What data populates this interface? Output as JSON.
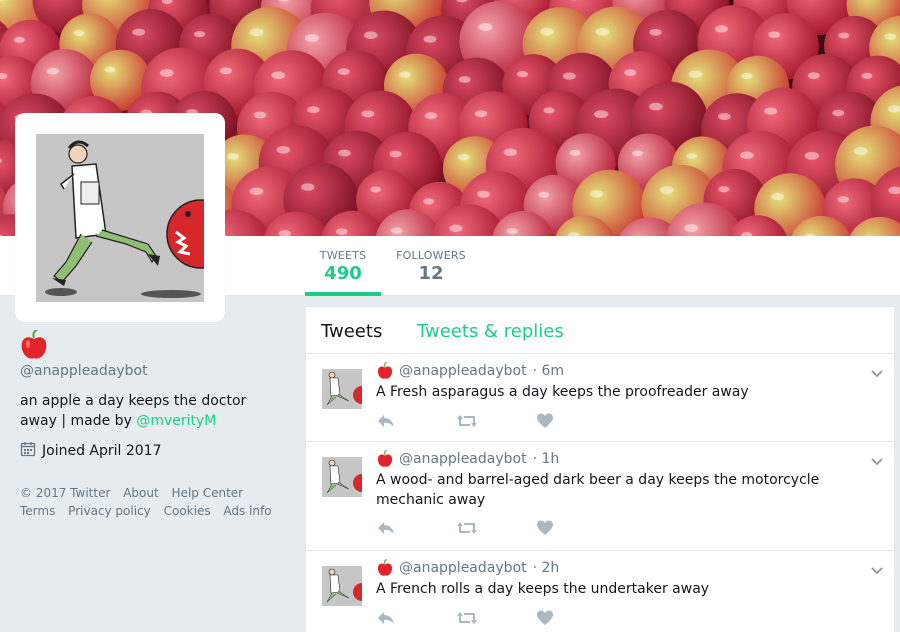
{
  "profile": {
    "handle": "@anappleadaybot",
    "bio_text": "an apple a day keeps the doctor away | made by ",
    "bio_link": "@mverityM",
    "joined": "Joined April 2017"
  },
  "stats": [
    {
      "label": "TWEETS",
      "value": "490",
      "active": true
    },
    {
      "label": "FOLLOWERS",
      "value": "12",
      "active": false
    }
  ],
  "tabs": {
    "tweets": "Tweets",
    "replies": "Tweets & replies"
  },
  "tweets": [
    {
      "handle": "@anappleadaybot",
      "time": "· 6m",
      "text": "A Fresh asparagus a day keeps the proofreader away"
    },
    {
      "handle": "@anappleadaybot",
      "time": "· 1h",
      "text": "A wood- and barrel-aged dark beer a day keeps the motorcycle mechanic away"
    },
    {
      "handle": "@anappleadaybot",
      "time": "· 2h",
      "text": "A French rolls a day keeps the undertaker away"
    }
  ],
  "footer": {
    "copyright": "© 2017 Twitter",
    "about": "About",
    "help": "Help Center",
    "terms": "Terms",
    "privacy": "Privacy policy",
    "cookies": "Cookies",
    "ads": "Ads info"
  },
  "colors": {
    "accent": "#19cf86",
    "muted": "#657786",
    "background": "#e6ecf0"
  },
  "icons": [
    "apple-icon",
    "calendar-icon",
    "reply-icon",
    "retweet-icon",
    "like-icon",
    "chevron-down-icon"
  ]
}
